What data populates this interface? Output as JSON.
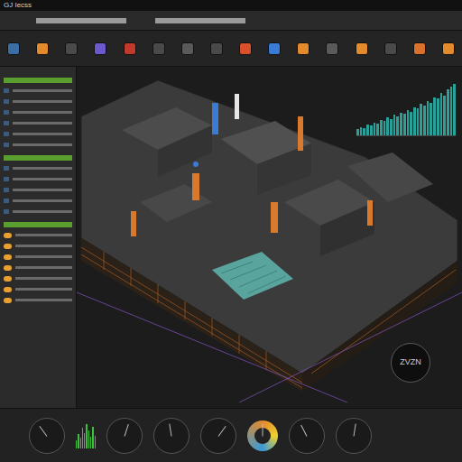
{
  "window": {
    "title": "GJ Iecss"
  },
  "toolbar": {
    "tools": [
      {
        "color": "#3a6ea5"
      },
      {
        "color": "#e38a2c"
      },
      {
        "color": "#4a4a4a"
      },
      {
        "color": "#6a5acd"
      },
      {
        "color": "#c0392b"
      },
      {
        "color": "#4a4a4a"
      },
      {
        "color": "#5a5a5a"
      },
      {
        "color": "#4a4a4a"
      },
      {
        "color": "#d9502b"
      },
      {
        "color": "#3a7bd5"
      },
      {
        "color": "#e38a2c"
      },
      {
        "color": "#5a5a5a"
      },
      {
        "color": "#e38a2c"
      },
      {
        "color": "#4a4a4a"
      },
      {
        "color": "#d9702b"
      },
      {
        "color": "#e38a2c"
      }
    ]
  },
  "left_panel": {
    "sections": [
      {
        "items": [
          {
            "marker": false
          },
          {
            "marker": false
          },
          {
            "marker": false
          },
          {
            "marker": false
          },
          {
            "marker": false
          },
          {
            "marker": false
          }
        ]
      },
      {
        "items": [
          {
            "marker": false
          },
          {
            "marker": false
          },
          {
            "marker": false
          },
          {
            "marker": false
          },
          {
            "marker": false
          }
        ]
      },
      {
        "items": [
          {
            "marker": true
          },
          {
            "marker": true
          },
          {
            "marker": true
          },
          {
            "marker": true
          },
          {
            "marker": true
          },
          {
            "marker": true
          },
          {
            "marker": true
          }
        ]
      }
    ]
  },
  "chart": {
    "series": [
      {
        "values": [
          12,
          15,
          14,
          20,
          18,
          24,
          22,
          28,
          26,
          33,
          30,
          38,
          35,
          42,
          40,
          47,
          44,
          52,
          50,
          58,
          55,
          64,
          60,
          70,
          68,
          78,
          74,
          85,
          90,
          95
        ]
      }
    ]
  },
  "histogram": {
    "values": [
      30,
      55,
      40,
      80,
      60,
      95,
      70,
      45,
      85,
      50
    ]
  },
  "gauges": [
    {
      "kind": "dial",
      "level": 0.3
    },
    {
      "kind": "dial",
      "level": 0.6
    },
    {
      "kind": "dial",
      "level": 0.45
    },
    {
      "kind": "dial",
      "level": 0.7
    },
    {
      "kind": "colored",
      "level": 0.5
    },
    {
      "kind": "dial",
      "level": 0.35
    },
    {
      "kind": "dial",
      "level": 0.55
    }
  ],
  "badge": {
    "label": "ZVZN"
  }
}
